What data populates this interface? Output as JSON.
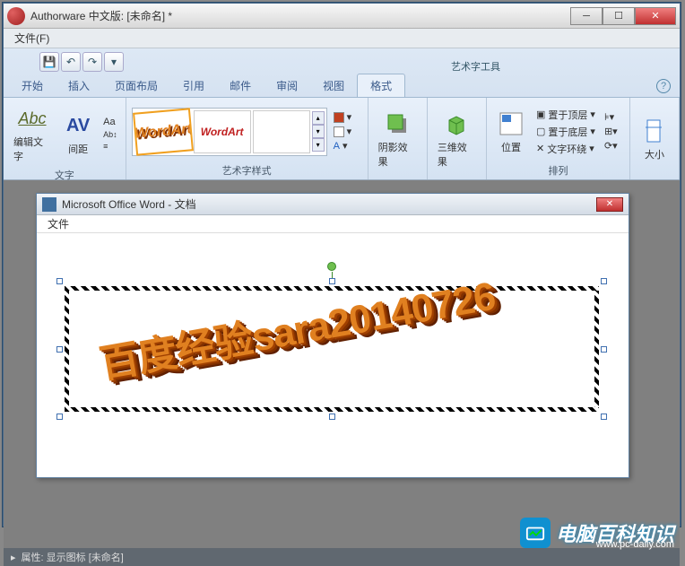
{
  "app": {
    "title": "Authorware 中文版: [未命名] *"
  },
  "menubar": {
    "file": "文件(F)"
  },
  "qat": {
    "save": "💾",
    "undo": "↶",
    "redo": "↷"
  },
  "context_tab_group": "艺术字工具",
  "tabs": {
    "start": "开始",
    "insert": "插入",
    "layout": "页面布局",
    "ref": "引用",
    "mail": "邮件",
    "review": "审阅",
    "view": "视图",
    "format": "格式"
  },
  "groups": {
    "text": {
      "label": "文字",
      "edit_text": "编辑文字",
      "spacing": "间距",
      "aa": "Aa",
      "av": "AV",
      "abc": "Abc"
    },
    "styles": {
      "label": "艺术字样式"
    },
    "shadow": {
      "label": "阴影效果"
    },
    "threeD": {
      "label": "三维效果"
    },
    "arrange": {
      "label": "排列",
      "position": "位置",
      "bring_front": "置于顶层",
      "send_back": "置于底层",
      "wrap": "文字环绕"
    },
    "size": {
      "label": "大小"
    }
  },
  "inner": {
    "title": "Microsoft Office Word  - 文档",
    "file": "文件"
  },
  "wordart_text": "百度经验sara20140726",
  "status": {
    "prefix": "属性: 显示图标 [未命名]"
  },
  "watermark": {
    "brand": "电脑百科知识",
    "url": "www.pc-daily.com"
  }
}
